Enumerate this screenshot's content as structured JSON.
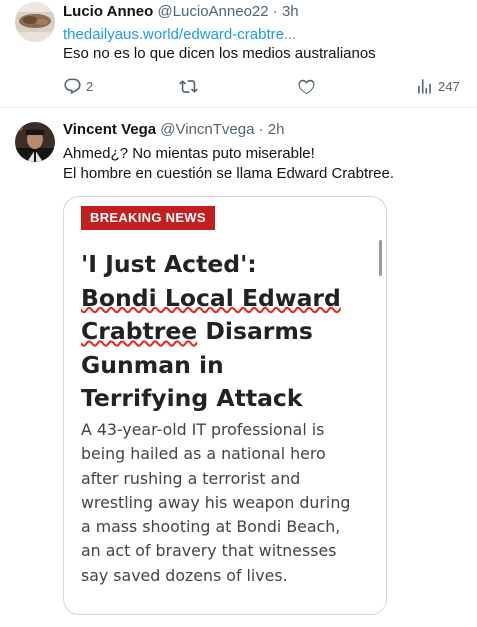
{
  "tweets": [
    {
      "name": "Lucio Anneo",
      "handle": "@LucioAnneo22",
      "time": "3h",
      "link": "thedailyaus.world/edward-crabtre...",
      "text": "Eso no es lo que dicen los medios australianos",
      "replies": "2",
      "views": "247"
    },
    {
      "name": "Vincent Vega",
      "handle": "@VincnTvega",
      "time": "2h",
      "lines": [
        "Ahmed¿? No mientas puto miserable!",
        "El hombre en cuestión se llama Edward Crabtree."
      ],
      "card": {
        "badge": "BREAKING NEWS",
        "headline_lines": [
          "'I Just Acted':",
          "Bondi Local Edward",
          "Crabtree",
          " Disarms",
          "Gunman in",
          "Terrifying Attack"
        ],
        "body_lines": [
          "A 43-year-old IT professional is",
          "being hailed as a national hero",
          "after rushing a terrorist and",
          "wrestling away his weapon during",
          "a mass shooting at Bondi Beach,",
          "an act of bravery that witnesses",
          "say saved dozens of lives."
        ]
      }
    }
  ],
  "icons": {
    "reply": "reply-icon",
    "retweet": "retweet-icon",
    "like": "like-icon",
    "views": "views-icon"
  },
  "colors": {
    "link": "#1d9bf0",
    "badge": "#c21f1f",
    "secondary_text": "#536471"
  }
}
